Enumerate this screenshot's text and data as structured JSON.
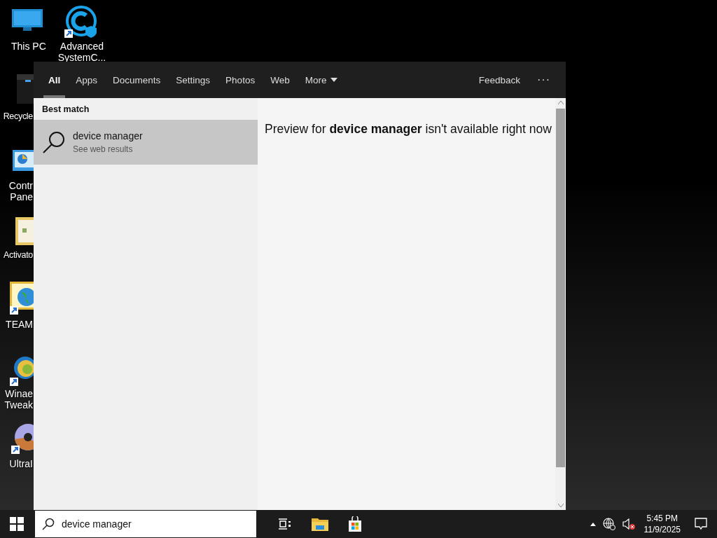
{
  "desktop_icons": [
    {
      "lines": [
        "This PC"
      ]
    },
    {
      "lines": [
        "Advanced",
        "SystemC..."
      ]
    },
    {
      "lines": [
        "Recycle"
      ]
    },
    {
      "lines": [
        "Contr",
        "Pane"
      ]
    },
    {
      "lines": [
        "Activato"
      ]
    },
    {
      "lines": [
        "TEAM"
      ]
    },
    {
      "lines": [
        "Winae",
        "Tweak"
      ]
    },
    {
      "lines": [
        "UltraI"
      ]
    }
  ],
  "search_panel": {
    "tabs": [
      {
        "label": "All",
        "selected": true,
        "kind": "tab"
      },
      {
        "label": "Apps",
        "selected": false,
        "kind": "tab"
      },
      {
        "label": "Documents",
        "selected": false,
        "kind": "tab"
      },
      {
        "label": "Settings",
        "selected": false,
        "kind": "tab"
      },
      {
        "label": "Photos",
        "selected": false,
        "kind": "tab"
      },
      {
        "label": "Web",
        "selected": false,
        "kind": "tab"
      },
      {
        "label": "More",
        "selected": false,
        "kind": "dropdown"
      }
    ],
    "feedback": "Feedback",
    "more_options": "···",
    "best_match_heading": "Best match",
    "results": [
      {
        "title": "device manager",
        "subtitle": "See web results",
        "selected": true
      }
    ],
    "preview": "Preview for **device manager** isn't available right now"
  },
  "taskbar": {
    "search": {
      "value": "device manager"
    },
    "clock": {
      "time": "5:45 PM",
      "date": "11/9/2025"
    }
  }
}
